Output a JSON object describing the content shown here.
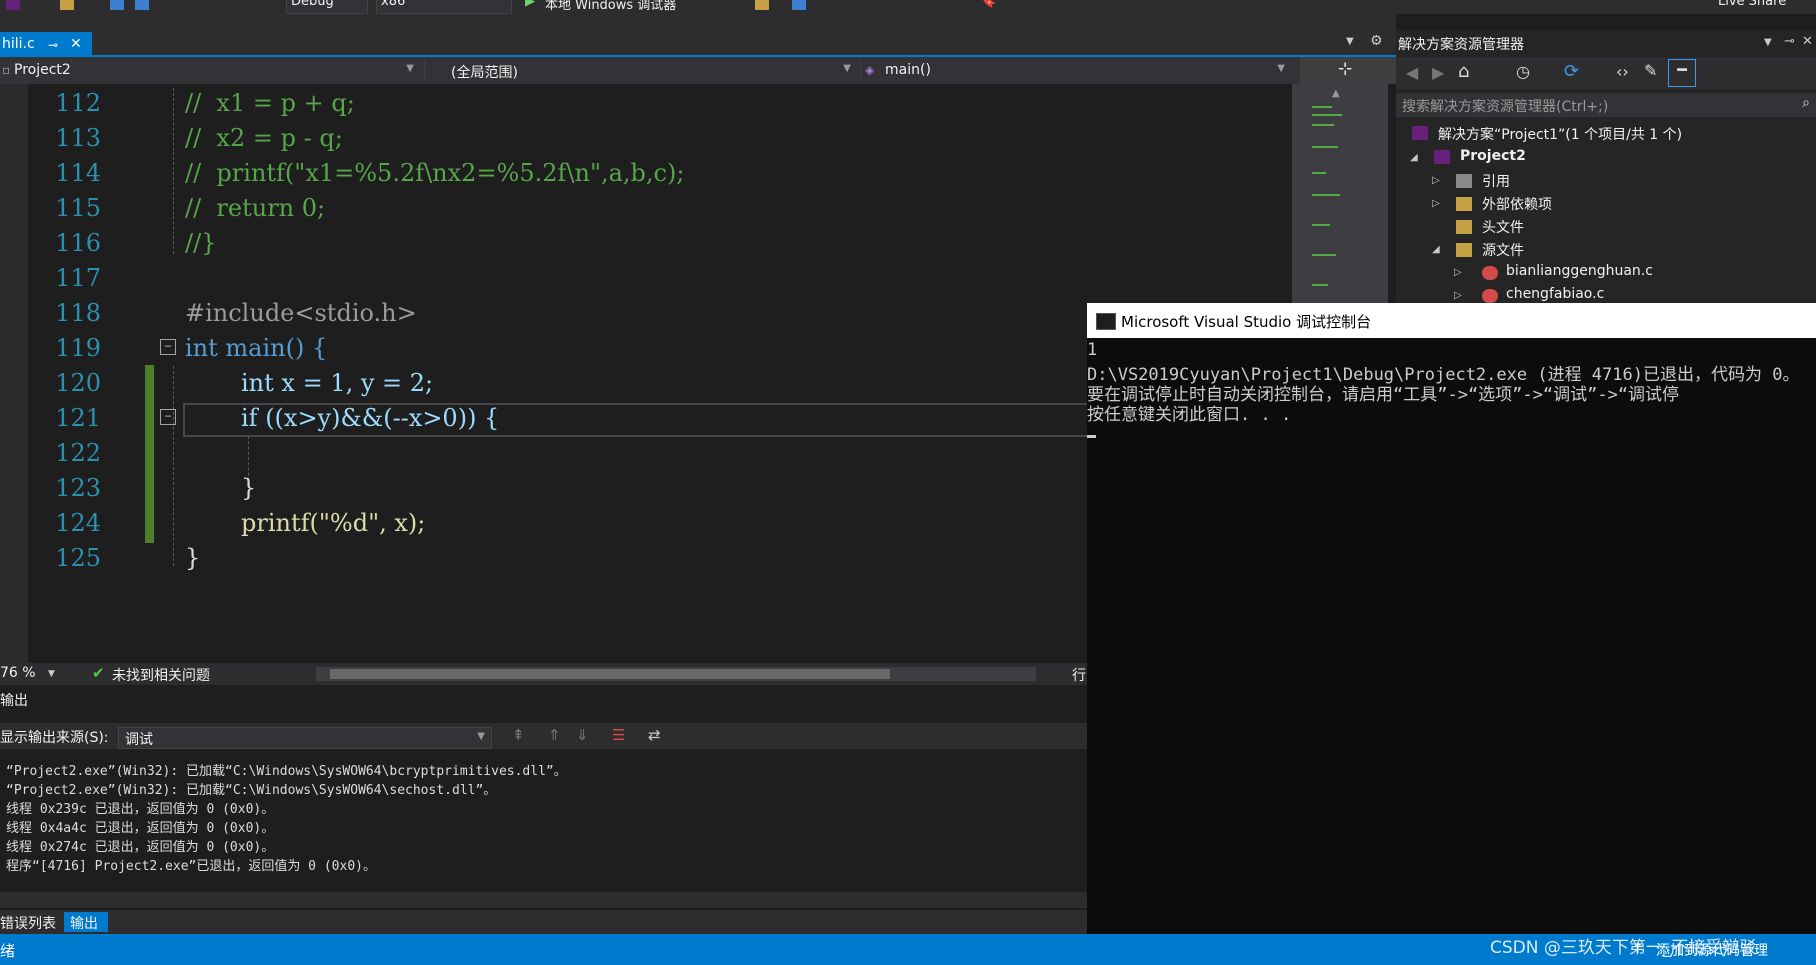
{
  "toolbar": {
    "config": "Debug",
    "platform": "x86",
    "run_label": "本地 Windows 调试器",
    "live_share": "Live Share"
  },
  "tabs": {
    "active_file": "hili.c",
    "pin": "⊕",
    "close": "✕"
  },
  "navbar": {
    "project": "Project2",
    "scope": "(全局范围)",
    "function": "main()"
  },
  "editor": {
    "lines": [
      {
        "n": "112",
        "text": "//  x1 = p + q;"
      },
      {
        "n": "113",
        "text": "//  x2 = p - q;"
      },
      {
        "n": "114",
        "text": "//  printf(\"x1=%5.2f\\nx2=%5.2f\\n\",a,b,c);"
      },
      {
        "n": "115",
        "text": "//  return 0;"
      },
      {
        "n": "116",
        "text": "//}"
      },
      {
        "n": "117",
        "text": ""
      },
      {
        "n": "118",
        "text": "#include<stdio.h>"
      },
      {
        "n": "119",
        "text": "int main() {"
      },
      {
        "n": "120",
        "text": "int x = 1, y = 2;"
      },
      {
        "n": "121",
        "text": "if ((x>y)&&(--x>0)) {"
      },
      {
        "n": "122",
        "text": ""
      },
      {
        "n": "123",
        "text": "}"
      },
      {
        "n": "124",
        "text": "printf(\"%d\", x);"
      },
      {
        "n": "125",
        "text": "}"
      }
    ]
  },
  "editor_status": {
    "zoom": "76 %",
    "issues": "未找到相关问题",
    "row_label": "行"
  },
  "output": {
    "title": "输出",
    "source_label": "显示输出来源(S):",
    "source_value": "调试",
    "lines": [
      "“Project2.exe”(Win32): 已加载“C:\\Windows\\SysWOW64\\bcryptprimitives.dll”。",
      "“Project2.exe”(Win32): 已加载“C:\\Windows\\SysWOW64\\sechost.dll”。",
      "线程 0x239c 已退出，返回值为 0 (0x0)。",
      "线程 0x4a4c 已退出，返回值为 0 (0x0)。",
      "线程 0x274c 已退出，返回值为 0 (0x0)。",
      "程序“[4716] Project2.exe”已退出，返回值为 0 (0x0)。"
    ]
  },
  "bottom_tabs": {
    "errors": "错误列表",
    "output": "输出"
  },
  "statusbar": {
    "ready": "绪",
    "add_source": "添加到源代码管理"
  },
  "solution_explorer": {
    "title": "解决方案资源管理器",
    "search_placeholder": "搜索解决方案资源管理器(Ctrl+;)",
    "solution": "解决方案“Project1”(1 个项目/共 1 个)",
    "project": "Project2",
    "references": "引用",
    "external_deps": "外部依赖项",
    "headers": "头文件",
    "sources": "源文件",
    "file1": "bianlianggenghuan.c",
    "file2": "chengfabiao.c"
  },
  "console": {
    "title": "Microsoft Visual Studio 调试控制台",
    "lines": [
      "1",
      "D:\\VS2019Cyuyan\\Project1\\Debug\\Project2.exe (进程 4716)已退出，代码为 0。",
      "要在调试停止时自动关闭控制台，请启用“工具”->“选项”->“调试”->“调试停",
      "按任意键关闭此窗口. . ."
    ]
  },
  "watermark": "CSDN @三玖天下第一_不接受辩驳",
  "colors": {
    "accent": "#007acc",
    "editor_bg": "#1e1e1e",
    "comment": "#57a64a",
    "keyword": "#569cd6",
    "line_number": "#2b91af"
  }
}
